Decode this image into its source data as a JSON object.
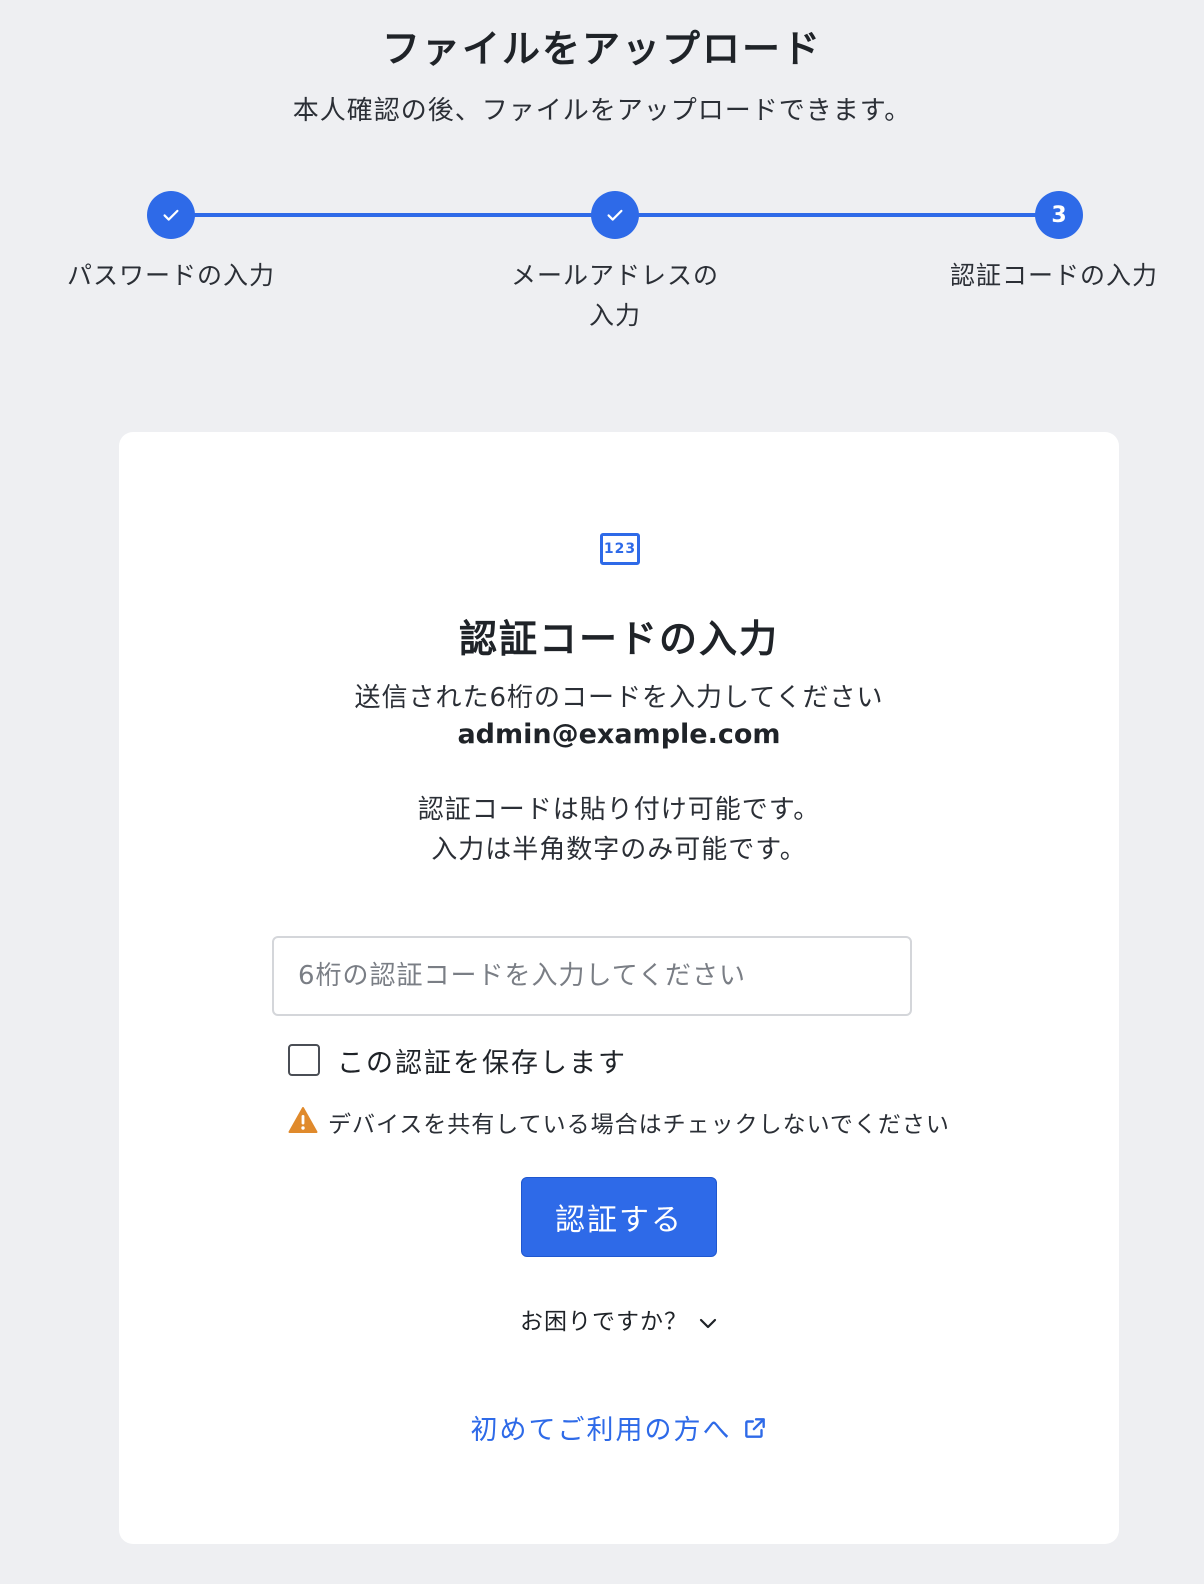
{
  "header": {
    "title": "ファイルをアップロード",
    "subtitle": "本人確認の後、ファイルをアップロードできます。"
  },
  "stepper": {
    "steps": [
      {
        "label": "パスワードの入力",
        "status": "completed",
        "icon": "check-icon"
      },
      {
        "label_line1": "メールアドレスの",
        "label_line2": "入力",
        "status": "completed",
        "icon": "check-icon"
      },
      {
        "number": "3",
        "label": "認証コードの入力",
        "status": "current"
      }
    ],
    "accent_color": "#2e6ae8"
  },
  "card": {
    "icon": "numeric-code-icon",
    "icon_text": "123",
    "title": "認証コードの入力",
    "instruction": "送信された6桁のコードを入力してください",
    "email": "admin@example.com",
    "note_line1": "認証コードは貼り付け可能です。",
    "note_line2": "入力は半角数字のみ可能です。",
    "code_input": {
      "value": "",
      "placeholder": "6桁の認証コードを入力してください"
    },
    "remember_checkbox": {
      "label": "この認証を保存します",
      "checked": false
    },
    "warning": {
      "icon": "warning-icon",
      "text": "デバイスを共有している場合はチェックしないでください",
      "color": "#e08a2c"
    },
    "verify_button": "認証する",
    "help_toggle": "お困りですか？",
    "first_time_link": "初めてご利用の方へ"
  }
}
